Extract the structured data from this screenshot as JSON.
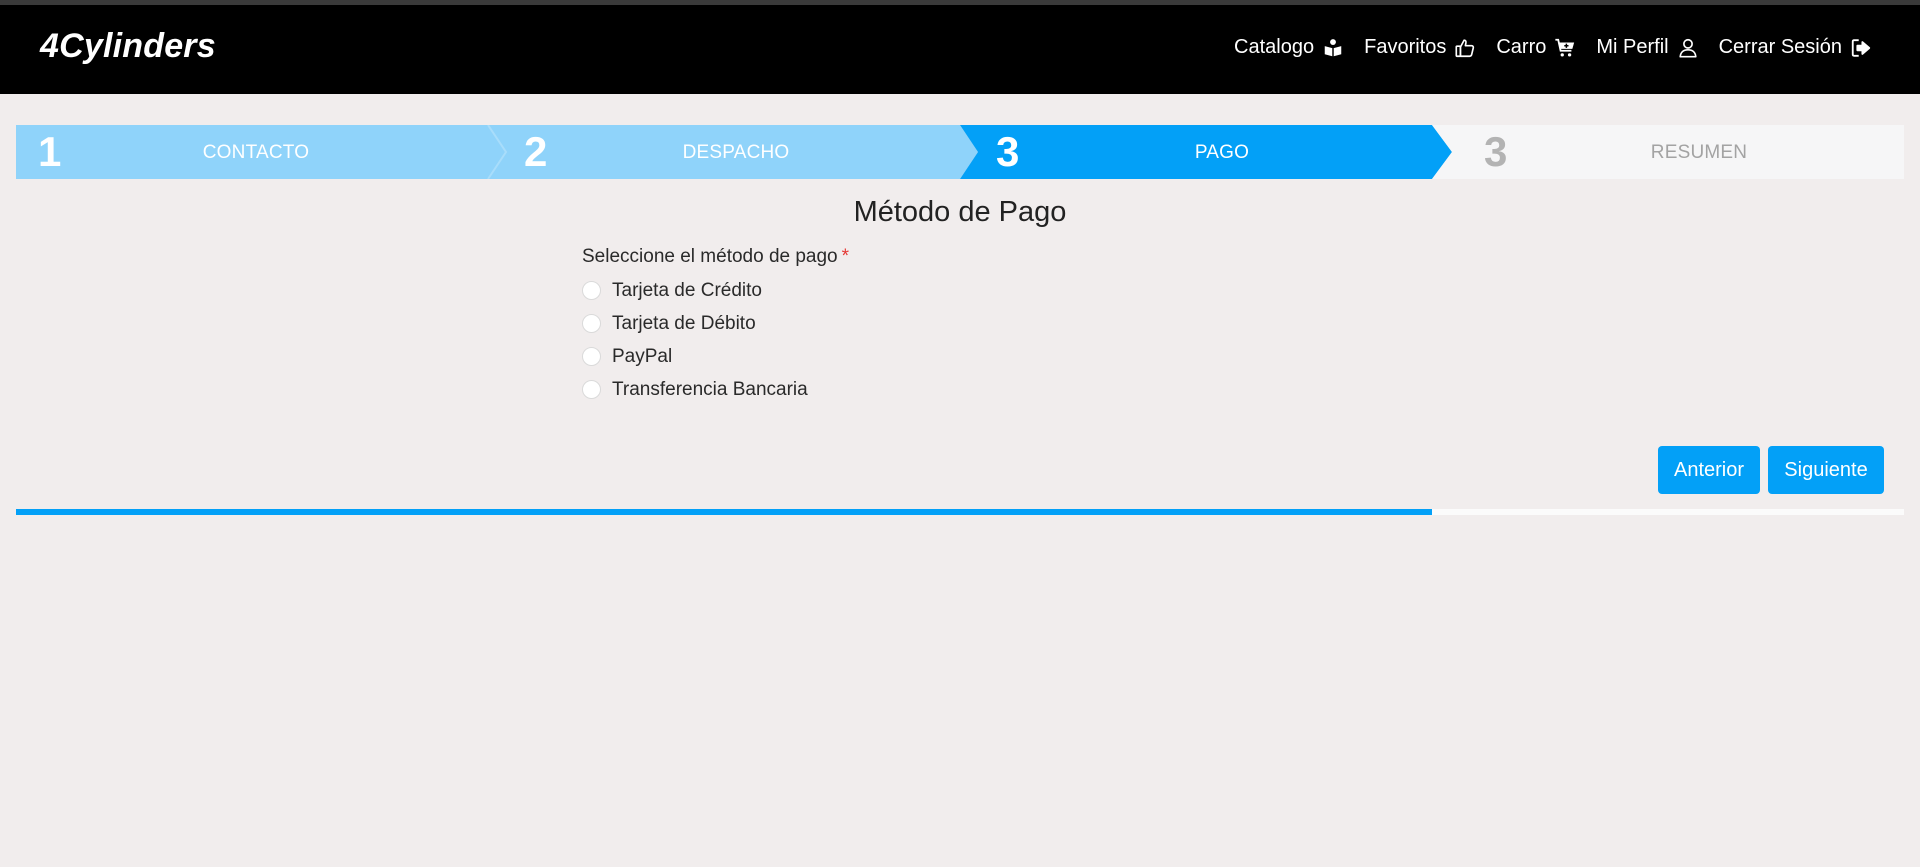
{
  "app": {
    "brand": "4Cylinders"
  },
  "nav": {
    "items": [
      {
        "label": "Catalogo",
        "icon": "book-reader-icon"
      },
      {
        "label": "Favoritos",
        "icon": "thumbs-up-icon"
      },
      {
        "label": "Carro",
        "icon": "shopping-cart-icon"
      },
      {
        "label": "Mi Perfil",
        "icon": "user-icon"
      },
      {
        "label": "Cerrar Sesión",
        "icon": "sign-out-icon"
      }
    ]
  },
  "stepper": {
    "steps": [
      {
        "number": "1",
        "label": "CONTACTO",
        "state": "completed"
      },
      {
        "number": "2",
        "label": "DESPACHO",
        "state": "completed"
      },
      {
        "number": "3",
        "label": "PAGO",
        "state": "active"
      },
      {
        "number": "3",
        "label": "RESUMEN",
        "state": "pending"
      }
    ],
    "colors": {
      "completed": "#8fd3fa",
      "active": "#03a0f7",
      "pending": "#f6f6f7",
      "pending_text": "#9e9e9e"
    }
  },
  "form": {
    "title": "Método de Pago",
    "label": "Seleccione el método de pago",
    "required_marker": "*",
    "options": [
      {
        "label": "Tarjeta de Crédito",
        "selected": false
      },
      {
        "label": "Tarjeta de Débito",
        "selected": false
      },
      {
        "label": "PayPal",
        "selected": false
      },
      {
        "label": "Transferencia Bancaria",
        "selected": false
      }
    ]
  },
  "buttons": {
    "prev_label": "Anterior",
    "next_label": "Siguiente"
  },
  "progress": {
    "value": 0.75,
    "color": "#03a0f7"
  }
}
